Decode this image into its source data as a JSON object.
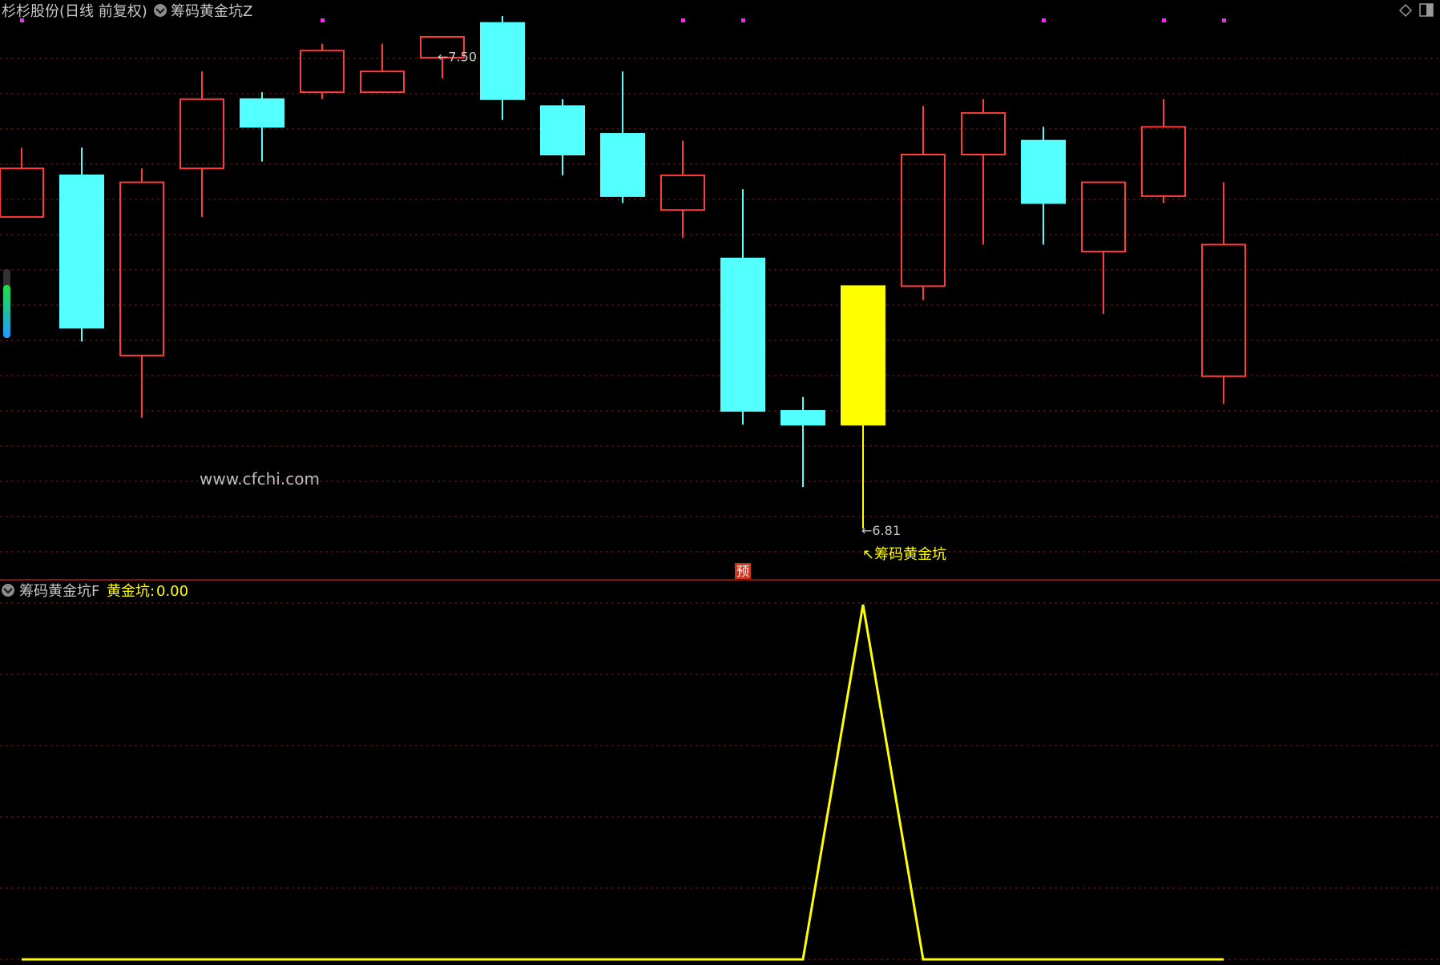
{
  "header": {
    "title": "杉杉股份(日线 前复权)",
    "indicator_main": "筹码黄金坑Z",
    "indicator_sub": "筹码黄金坑F",
    "sub_series_label": "黄金坑:",
    "sub_series_value": "0.00"
  },
  "watermark": "www.cfchi.com",
  "markers": {
    "pre_badge": "预",
    "signal_label": "↖筹码黄金坑",
    "high_label": "←7.50",
    "low_label": "←6.81"
  },
  "colors": {
    "background": "#000000",
    "up": "#ff3b3b",
    "down": "#54ffff",
    "signal": "#ffff00",
    "grid": "#7a1a1a",
    "separator": "#b01818",
    "dot": "#ff22ff",
    "header_text": "#c8c8c8"
  },
  "chart_data": [
    {
      "type": "candlestick",
      "title": "杉杉股份(日线 前复权)",
      "y_range": [
        6.75,
        7.55
      ],
      "grid": true,
      "candles": [
        {
          "open": 7.26,
          "close": 7.33,
          "high": 7.36,
          "low": 7.26,
          "color": "up"
        },
        {
          "open": 7.32,
          "close": 7.1,
          "high": 7.36,
          "low": 7.08,
          "color": "down"
        },
        {
          "open": 7.06,
          "close": 7.31,
          "high": 7.33,
          "low": 6.97,
          "color": "up"
        },
        {
          "open": 7.33,
          "close": 7.43,
          "high": 7.47,
          "low": 7.26,
          "color": "up"
        },
        {
          "open": 7.43,
          "close": 7.39,
          "high": 7.44,
          "low": 7.34,
          "color": "down"
        },
        {
          "open": 7.44,
          "close": 7.5,
          "high": 7.51,
          "low": 7.43,
          "color": "up"
        },
        {
          "open": 7.44,
          "close": 7.47,
          "high": 7.51,
          "low": 7.44,
          "color": "up"
        },
        {
          "open": 7.49,
          "close": 7.52,
          "high": 7.52,
          "low": 7.46,
          "color": "up"
        },
        {
          "open": 7.54,
          "close": 7.43,
          "high": 7.55,
          "low": 7.4,
          "color": "down"
        },
        {
          "open": 7.42,
          "close": 7.35,
          "high": 7.43,
          "low": 7.32,
          "color": "down"
        },
        {
          "open": 7.38,
          "close": 7.29,
          "high": 7.47,
          "low": 7.28,
          "color": "down"
        },
        {
          "open": 7.27,
          "close": 7.32,
          "high": 7.37,
          "low": 7.23,
          "color": "up"
        },
        {
          "open": 7.2,
          "close": 6.98,
          "high": 7.3,
          "low": 6.96,
          "color": "down"
        },
        {
          "open": 6.98,
          "close": 6.96,
          "high": 7.0,
          "low": 6.87,
          "color": "down"
        },
        {
          "open": 7.16,
          "close": 6.96,
          "high": 7.16,
          "low": 6.81,
          "color": "signal"
        },
        {
          "open": 7.16,
          "close": 7.35,
          "high": 7.42,
          "low": 7.14,
          "color": "up"
        },
        {
          "open": 7.35,
          "close": 7.41,
          "high": 7.43,
          "low": 7.22,
          "color": "up"
        },
        {
          "open": 7.37,
          "close": 7.28,
          "high": 7.39,
          "low": 7.22,
          "color": "down"
        },
        {
          "open": 7.21,
          "close": 7.31,
          "high": 7.31,
          "low": 7.12,
          "color": "up"
        },
        {
          "open": 7.29,
          "close": 7.39,
          "high": 7.43,
          "low": 7.28,
          "color": "up"
        },
        {
          "open": 7.03,
          "close": 7.22,
          "high": 7.31,
          "low": 6.99,
          "color": "up"
        }
      ],
      "dot_markers_at_index": [
        0,
        5,
        11,
        12,
        17,
        19,
        20
      ],
      "high_annotation": 7.5,
      "low_annotation": 6.81,
      "signal_index": 14,
      "pre_badge_index": 12
    },
    {
      "type": "line",
      "title": "筹码黄金坑F",
      "series": [
        {
          "name": "黄金坑",
          "values": [
            0,
            0,
            0,
            0,
            0,
            0,
            0,
            0,
            0,
            0,
            0,
            0,
            0,
            0,
            1,
            0,
            0,
            0,
            0,
            0,
            0
          ]
        }
      ],
      "y_range": [
        0,
        1
      ],
      "grid": true
    }
  ]
}
